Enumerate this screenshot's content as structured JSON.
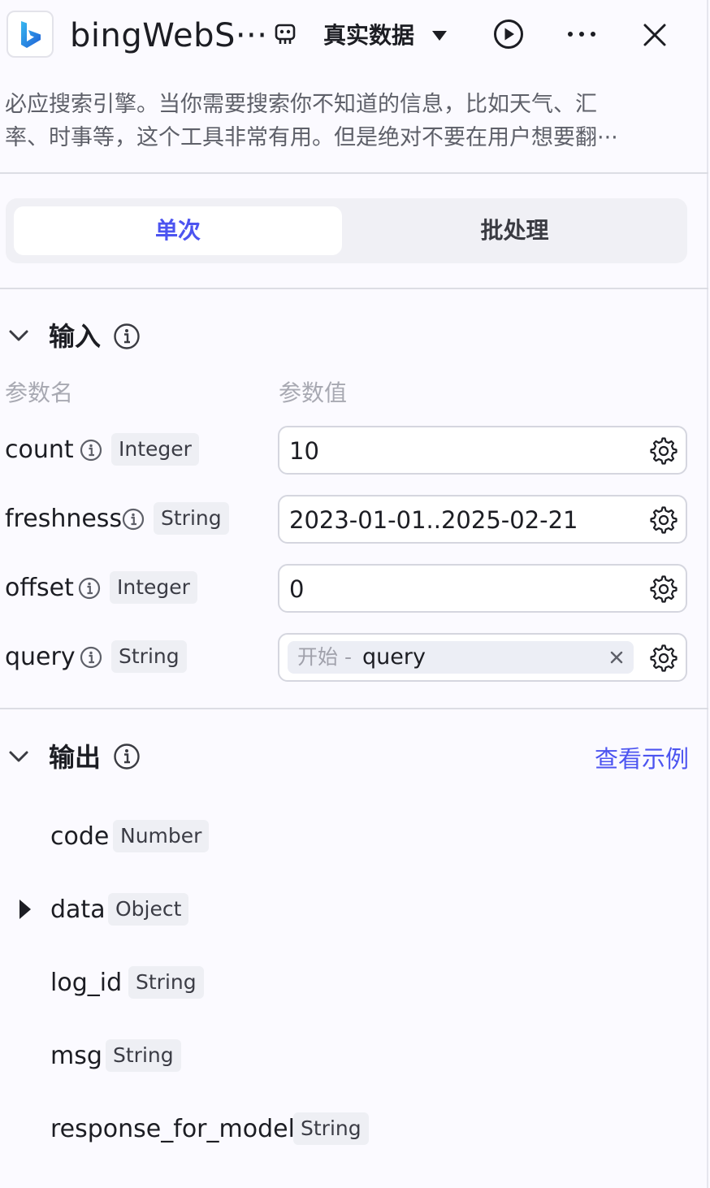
{
  "header": {
    "title": "bingWebS···",
    "data_source": "真实数据",
    "icons": [
      "bing-logo",
      "debug-icon",
      "chevron-down-icon",
      "run-icon",
      "more-icon",
      "close-icon"
    ]
  },
  "description": {
    "line1": "必应搜索引擎。当你需要搜索你不知道的信息，比如天气、汇",
    "line2": "率、时事等，这个工具非常有用。但是绝对不要在用户想要翻···"
  },
  "tabs": {
    "single": "单次",
    "batch": "批处理",
    "active": "single"
  },
  "input": {
    "title": "输入",
    "col_name": "参数名",
    "col_value": "参数值",
    "params": [
      {
        "name": "count",
        "type": "Integer",
        "value": "10"
      },
      {
        "name": "freshness",
        "type": "String",
        "value": "2023-01-01..2025-02-21"
      },
      {
        "name": "offset",
        "type": "Integer",
        "value": "0"
      },
      {
        "name": "query",
        "type": "String",
        "ref_prefix": "开始 -",
        "ref_var": "query"
      }
    ]
  },
  "output": {
    "title": "输出",
    "view_example": "查看示例",
    "fields": [
      {
        "name": "code",
        "type": "Number"
      },
      {
        "name": "data",
        "type": "Object",
        "expandable": true
      },
      {
        "name": "log_id",
        "type": "String"
      },
      {
        "name": "msg",
        "type": "String"
      },
      {
        "name": "response_for_model",
        "type": "String"
      }
    ]
  },
  "colors": {
    "accent": "#4c54f0",
    "background": "#fbfaff",
    "bing_blue": "#2f7de1"
  }
}
